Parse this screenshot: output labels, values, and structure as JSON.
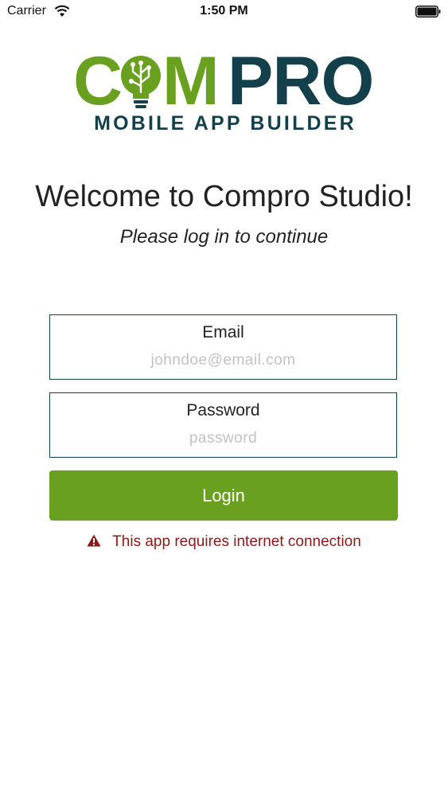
{
  "status_bar": {
    "carrier": "Carrier",
    "time": "1:50 PM",
    "icons": [
      "wifi-icon",
      "battery-icon"
    ]
  },
  "logo": {
    "word_left": "C",
    "word_mid": "M",
    "word_right": "PRO",
    "tagline": "MOBILE APP BUILDER",
    "icon": "lightbulb-icon",
    "colors": {
      "green": "#6aa020",
      "navy": "#14404b"
    }
  },
  "header": {
    "title": "Welcome to Compro Studio!",
    "subtitle": "Please log in to continue"
  },
  "form": {
    "email": {
      "label": "Email",
      "value": "",
      "placeholder": "johndoe@email.com"
    },
    "password": {
      "label": "Password",
      "value": "",
      "placeholder": "password"
    },
    "login_label": "Login"
  },
  "warning": {
    "icon": "warning-triangle-icon",
    "text": "This app requires internet connection",
    "color": "#8a1a1a"
  }
}
